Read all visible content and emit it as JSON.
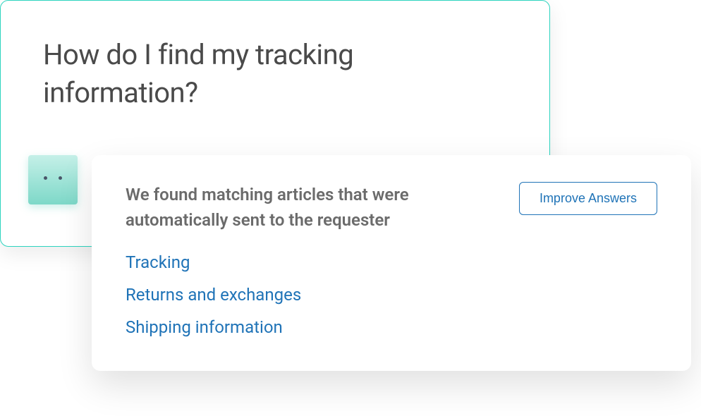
{
  "question": {
    "title": "How do I find my tracking information?"
  },
  "answer": {
    "header_text": "We found matching articles that were automatically sent to the requester",
    "improve_button_label": "Improve Answers",
    "articles": [
      {
        "label": "Tracking"
      },
      {
        "label": "Returns and exchanges"
      },
      {
        "label": "Shipping information"
      }
    ]
  }
}
